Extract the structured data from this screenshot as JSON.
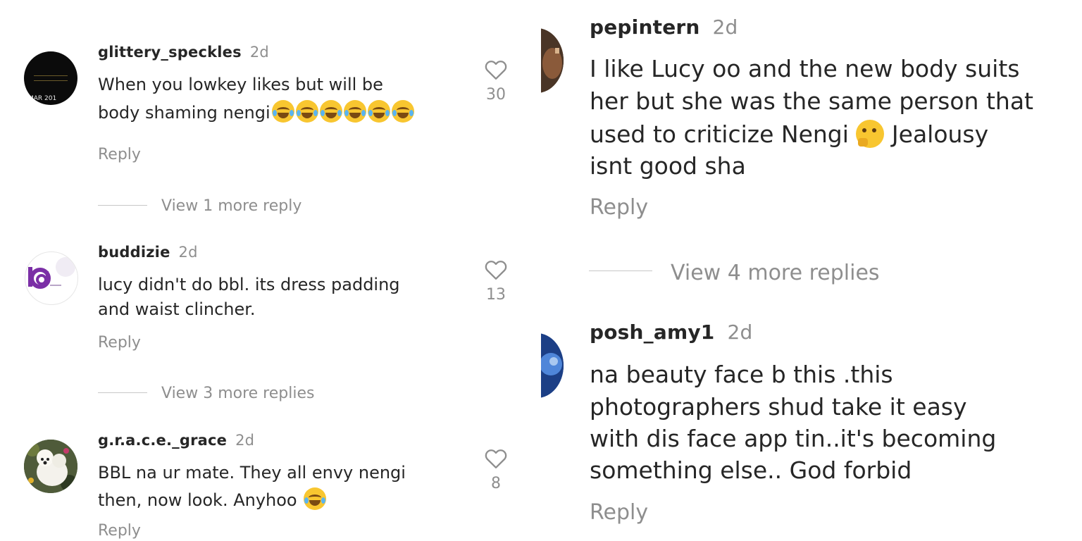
{
  "left_panel": {
    "comments": [
      {
        "username": "glittery_speckles",
        "time": "2d",
        "line1": "When you lowkey likes but will be",
        "line2": "body shaming nengi",
        "emoji_count": 6,
        "emoji": "face-with-tears-of-joy",
        "reply": "Reply",
        "likes": "30",
        "avatar_text": "MAR 201"
      },
      {
        "username": "buddizie",
        "time": "2d",
        "line1": "lucy didn't do bbl. its dress padding",
        "line2": "and waist clincher.",
        "reply": "Reply",
        "likes": "13"
      },
      {
        "username": "g.r.a.c.e._grace",
        "time": "2d",
        "line1": "BBL na ur mate. They all envy nengi",
        "line2": "then, now look. Anyhoo",
        "emoji_count": 1,
        "emoji": "face-with-tears-of-joy",
        "reply": "Reply",
        "likes": "8"
      }
    ],
    "view_more": [
      "View 1 more reply",
      "View 3 more replies"
    ]
  },
  "right_panel": {
    "comments": [
      {
        "username": "pepintern",
        "time": "2d",
        "lines": [
          "I like Lucy oo and the new body suits",
          "her but she was the same person that",
          "used to criticize Nengi",
          "Jealousy",
          "isnt good sha"
        ],
        "emoji": "thinking-face",
        "reply": "Reply"
      },
      {
        "username": "posh_amy1",
        "time": "2d",
        "lines": [
          "na beauty face b this .this",
          "photographers shud take it easy",
          "with dis face app tin..it's becoming",
          "something else.. God forbid"
        ],
        "reply": "Reply"
      }
    ],
    "view_more": [
      "View 4 more replies"
    ]
  },
  "colors": {
    "text": "#262626",
    "muted": "#8e8e8e",
    "buddizie_purple": "#7b2fa6"
  }
}
